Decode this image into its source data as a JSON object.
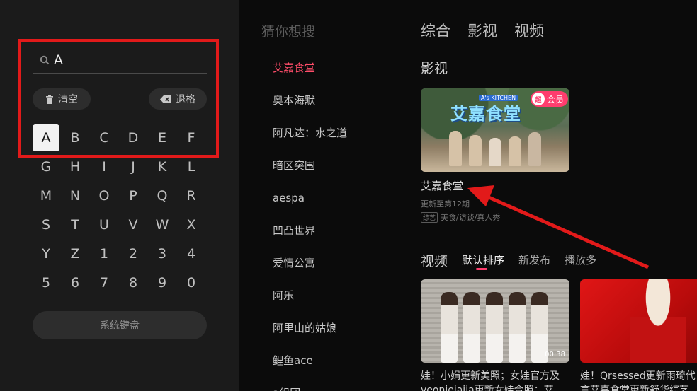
{
  "search": {
    "query": "A",
    "clear_label": "清空",
    "backspace_label": "退格",
    "system_keyboard_label": "系统键盘"
  },
  "keyboard": {
    "keys": [
      "A",
      "B",
      "C",
      "D",
      "E",
      "F",
      "G",
      "H",
      "I",
      "J",
      "K",
      "L",
      "M",
      "N",
      "O",
      "P",
      "Q",
      "R",
      "S",
      "T",
      "U",
      "V",
      "W",
      "X",
      "Y",
      "Z",
      "1",
      "2",
      "3",
      "4",
      "5",
      "6",
      "7",
      "8",
      "9",
      "0"
    ],
    "active_key": "A"
  },
  "suggestions": {
    "title": "猜你想搜",
    "items": [
      "艾嘉食堂",
      "奥本海默",
      "阿凡达：水之道",
      "暗区突围",
      "aespa",
      "凹凸世界",
      "爱情公寓",
      "阿乐",
      "阿里山的姑娘",
      "鲤鱼ace"
    ],
    "active_index": 0,
    "cut_item": "a组团"
  },
  "tabs": [
    "综合",
    "影视",
    "视频"
  ],
  "film_section": {
    "title": "影视",
    "card": {
      "title": "艾嘉食堂",
      "update": "更新至第12期",
      "genre_tag": "综艺",
      "genres": "美食/访谈/真人秀",
      "badge": "会员",
      "badge_tag": "超",
      "art_title": "艾嘉食堂",
      "art_logo": "A's KITCHEN"
    }
  },
  "video_section": {
    "title": "视频",
    "sort_tabs": [
      "默认排序",
      "新发布",
      "播放多"
    ],
    "active_sort": 0,
    "videos": [
      {
        "title": "娃！小娟更新美照；女娃官方及yeonjeiaiia更新女娃合照：艾",
        "duration": "00:38"
      },
      {
        "title": "娃！Qrsessed更新雨琦代言艾嘉食堂更新舒华综艺美照",
        "duration": ""
      }
    ]
  },
  "colors": {
    "accent": "#ff3d6e",
    "annotation": "#e21a1a",
    "background": "#0b0b0b",
    "panel": "#1b1b1b"
  }
}
